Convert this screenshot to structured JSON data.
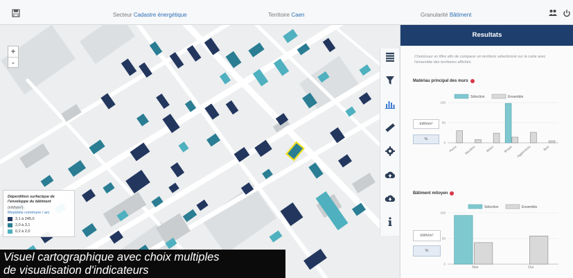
{
  "topbar": {
    "secteur_label": "Secteur",
    "secteur_value": "Cadastre énergétique",
    "territoire_label": "Territoire",
    "territoire_value": "Caen",
    "granularite_label": "Granularité",
    "granularite_value": "Bâtiment",
    "icons": [
      "save-icon",
      "users-icon",
      "power-icon"
    ]
  },
  "map": {
    "zoom_in": "+",
    "zoom_out": "-",
    "legend": {
      "title": "Déperdition surfacique de l'enveloppe du bâtiment",
      "unit": "(kWh/m²)",
      "method": "Moyenne commune / arc",
      "classes": [
        {
          "label": "3,1 à 245,0",
          "color": "#22365e"
        },
        {
          "label": "2,0 à 3,1",
          "color": "#2a7d93"
        },
        {
          "label": "0,2 à 2,0",
          "color": "#4fb0bf"
        }
      ]
    }
  },
  "caption": {
    "line1": "Visuel cartographique avec choix multiples",
    "line2": "de visualisation d'indicateurs"
  },
  "toolbar": {
    "icons": [
      "table-icon",
      "filter-icon",
      "bar-chart-icon",
      "ruler-icon",
      "gear-icon",
      "cloud-upload-icon",
      "cloud-download-icon",
      "info-icon"
    ]
  },
  "panel": {
    "title": "Resultats",
    "intro": "Choisissez un filtre afin de comparer un territoire sélectionné sur la carte avec l'ensemble des territoires affichés.",
    "colors": {
      "selection": "#7fc8cf",
      "ensemble": "#d9d9d9",
      "header": "#1e3f6e"
    },
    "section1": {
      "title": "Matériau principal des murs",
      "unit_btn": "kWh/m²",
      "pct_btn": "%",
      "legend": [
        "Sélection",
        "Ensemble"
      ]
    },
    "section2": {
      "title": "Bâtiment mitoyen",
      "unit_btn": "kWh/m²",
      "pct_btn": "%",
      "legend": [
        "Sélection",
        "Ensemble"
      ]
    }
  },
  "chart_data": [
    {
      "type": "bar",
      "title": "Matériau principal des murs",
      "categories": [
        "Pierre",
        "Meulière",
        "Béton",
        "Brique",
        "Agglomérés",
        "Bois"
      ],
      "series": [
        {
          "name": "Sélection",
          "values": [
            0,
            0,
            0,
            98,
            0,
            0
          ]
        },
        {
          "name": "Ensemble",
          "values": [
            30,
            8,
            24,
            14,
            26,
            5
          ]
        }
      ],
      "ylim": [
        0,
        100
      ],
      "yticks": [
        100,
        50,
        0
      ],
      "legend": "top"
    },
    {
      "type": "bar",
      "title": "Bâtiment mitoyen",
      "categories": [
        "Non",
        "Oui"
      ],
      "series": [
        {
          "name": "Sélection",
          "values": [
            95,
            0
          ]
        },
        {
          "name": "Ensemble",
          "values": [
            42,
            55
          ]
        }
      ],
      "ylim": [
        0,
        100
      ],
      "yticks": [
        100,
        50,
        0
      ],
      "legend": "top"
    }
  ]
}
